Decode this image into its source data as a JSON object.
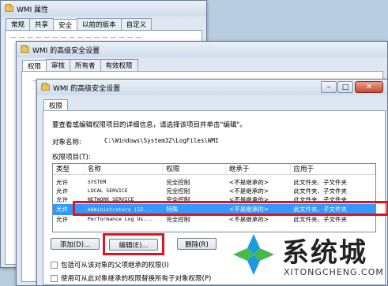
{
  "win1": {
    "title": "WMI 属性",
    "tabs": [
      "常规",
      "共享",
      "安全",
      "以前的版本",
      "自定义"
    ],
    "active_tab": 2
  },
  "win2": {
    "title": "WMI 的高级安全设置",
    "tabs": [
      "权限",
      "审核",
      "所有者",
      "有效权限"
    ],
    "active_tab": 0
  },
  "win3": {
    "title": "WMI 的高级安全设置",
    "tab": "权限",
    "intro": "要查看或编辑权限项目的详细信息，请选择该项目并单击\"编辑\"。",
    "object_label": "对象名称:",
    "object_value": "C:\\Windows\\System32\\LogFiles\\WMI",
    "entries_label": "权限项目(T):",
    "columns": [
      "类型",
      "名称",
      "权限",
      "继承于",
      "应用于"
    ],
    "rows": [
      [
        "允许",
        "SYSTEM",
        "完全控制",
        "<不是继承的>",
        "此文件夹、子文件夹"
      ],
      [
        "允许",
        "LOCAL SERVICE",
        "完全控制",
        "<不是继承的>",
        "此文件夹、子文件夹"
      ],
      [
        "允许",
        "NETWORK SERVICE",
        "完全控制",
        "<不是继承的>",
        "此文件夹、子文件夹"
      ],
      [
        "允许",
        "Administrators (ZZ...",
        "特殊",
        "<不是继承的>",
        "此文件夹、子文件夹"
      ],
      [
        "允许",
        "Performance Log Us...",
        "完全控制",
        "<不是继承的>",
        "此文件夹、子文件夹"
      ]
    ],
    "selected_row": 3,
    "add_button": "添加(D)...",
    "edit_button": "编辑(E)...",
    "delete_button": "删除(R)",
    "check1": "包括可从该对象的父项继承的权限(I)",
    "check2": "使用可从此对象继承的权限替换所有子对象权限(P)"
  },
  "watermark": {
    "brand_cn": "系统城",
    "brand_url": "XITONGCHENG.COM"
  },
  "colors": {
    "highlight_box": "#e0141e",
    "selection": "#3399ff"
  }
}
